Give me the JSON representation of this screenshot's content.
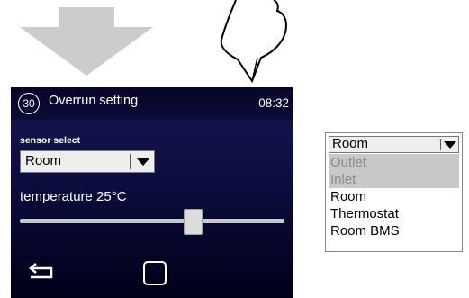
{
  "header": {
    "step": "30",
    "title": "Overrun setting",
    "time": "08:32"
  },
  "sensor": {
    "label": "sensor select",
    "value": "Room"
  },
  "temperature": {
    "label": "temperature 25°C",
    "slider_fraction": 0.65
  },
  "dropdown": {
    "value": "Room",
    "options": [
      {
        "label": "Outlet",
        "enabled": false
      },
      {
        "label": "Inlet",
        "enabled": false
      },
      {
        "label": "Room",
        "enabled": true
      },
      {
        "label": "Thermostat",
        "enabled": true
      },
      {
        "label": "Room BMS",
        "enabled": true
      }
    ]
  },
  "icons": {
    "arrow": "down-arrow-icon",
    "hand": "pointing-hand-icon",
    "back": "back-arrow-icon",
    "home": "home-square-icon",
    "dropdown": "chevron-down-icon"
  },
  "colors": {
    "screen_bg": "#0c0d3f",
    "disabled_bg": "#c8c8c8",
    "arrow": "#cccccc"
  }
}
